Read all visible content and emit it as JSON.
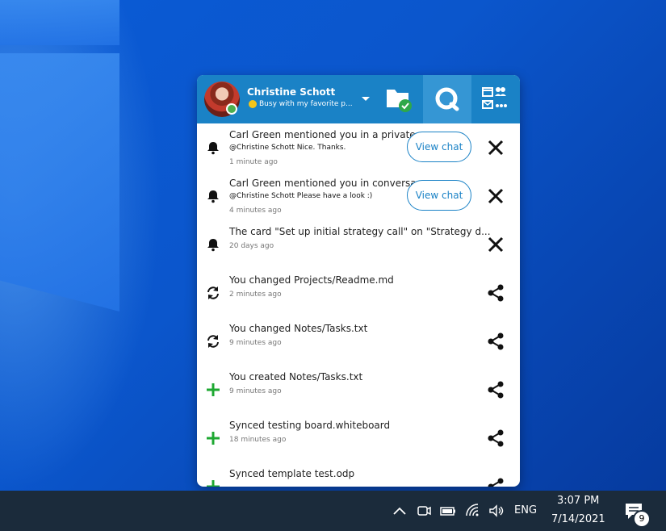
{
  "user": {
    "name": "Christine Schott",
    "status": "Busy with my favorite p..."
  },
  "notifications": [
    {
      "icon": "bell-icon",
      "title": "Carl Green mentioned you in a private...",
      "subtitle": "@Christine Schott Nice. Thanks.",
      "time": "1 minute ago",
      "action": "View chat",
      "trailing": "close-icon"
    },
    {
      "icon": "bell-icon",
      "title": "Carl Green mentioned you in conversa...",
      "subtitle": "@Christine Schott Please have a look :)",
      "time": "4 minutes ago",
      "action": "View chat",
      "trailing": "close-icon"
    },
    {
      "icon": "bell-icon",
      "title": "The card \"Set up initial strategy call\" on \"Strategy d...",
      "subtitle": "",
      "time": "20 days ago",
      "action": "",
      "trailing": "close-icon"
    },
    {
      "icon": "sync-icon",
      "title": "You changed Projects/Readme.md",
      "subtitle": "",
      "time": "2 minutes ago",
      "action": "",
      "trailing": "share-icon"
    },
    {
      "icon": "sync-icon",
      "title": "You changed Notes/Tasks.txt",
      "subtitle": "",
      "time": "9 minutes ago",
      "action": "",
      "trailing": "share-icon"
    },
    {
      "icon": "plus-icon",
      "title": "You created Notes/Tasks.txt",
      "subtitle": "",
      "time": "9 minutes ago",
      "action": "",
      "trailing": "share-icon"
    },
    {
      "icon": "plus-icon",
      "title": "Synced testing board.whiteboard",
      "subtitle": "",
      "time": "18 minutes ago",
      "action": "",
      "trailing": "share-icon"
    },
    {
      "icon": "plus-icon",
      "title": "Synced template test.odp",
      "subtitle": "",
      "time": "",
      "action": "",
      "trailing": "share-icon"
    }
  ],
  "taskbar": {
    "language": "ENG",
    "time": "3:07 PM",
    "date": "7/14/2021",
    "notification_count": "9"
  },
  "colors": {
    "accent": "#1a82c6",
    "accent_active": "#3596d4",
    "plus": "#1ea832",
    "taskbar": "#1b2b3b"
  }
}
